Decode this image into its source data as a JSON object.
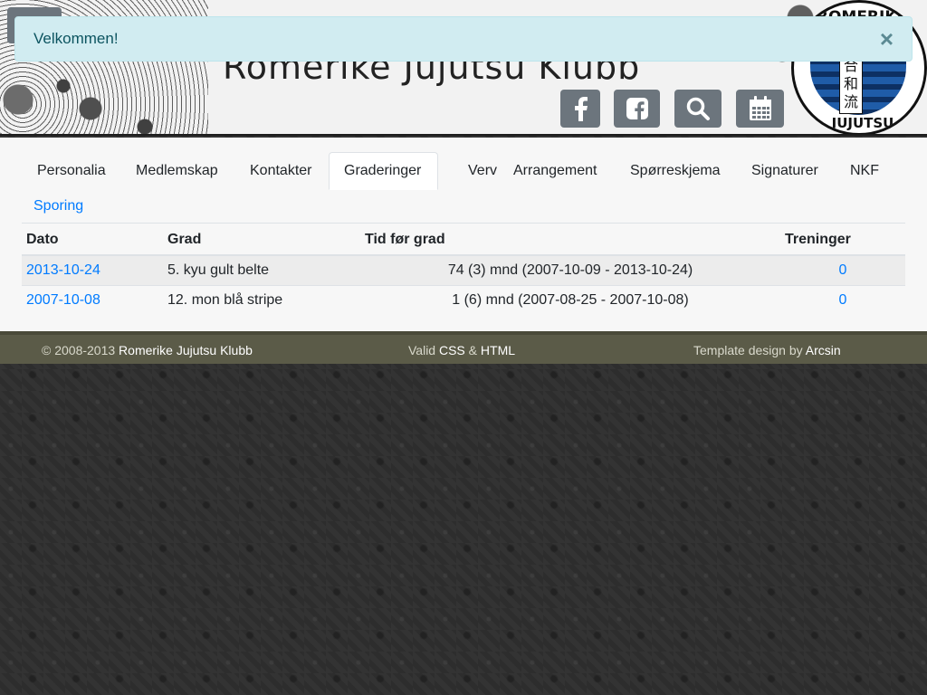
{
  "alert": {
    "message": "Velkommen!",
    "close_glyph": "×"
  },
  "header": {
    "title": "Romerike Jujutsu Klubb",
    "icons": [
      "facebook-icon",
      "facebook-square-icon",
      "search-icon",
      "calendar-icon"
    ],
    "logo": {
      "top_text": "ROMERIKE",
      "bottom_text": "JUJUTSU KLUBB",
      "kanji": "合和流"
    }
  },
  "tabs": [
    {
      "label": "Personalia"
    },
    {
      "label": "Medlemskap"
    },
    {
      "label": "Kontakter"
    },
    {
      "label": "Graderinger"
    },
    {
      "label": "Verv"
    },
    {
      "label": "Arrangement"
    },
    {
      "label": "Spørreskjema"
    },
    {
      "label": "Signaturer"
    },
    {
      "label": "NKF"
    },
    {
      "label": "Sporing"
    }
  ],
  "active_tab": "Graderinger",
  "table": {
    "headers": {
      "dato": "Dato",
      "grad": "Grad",
      "tid": "Tid før grad",
      "treninger": "Treninger"
    },
    "rows": [
      {
        "dato": "2013-10-24",
        "grad": "5. kyu gult belte",
        "tid": "74 (3) mnd (2007-10-09 - 2013-10-24)",
        "treninger": "0"
      },
      {
        "dato": "2007-10-08",
        "grad": "12. mon blå stripe",
        "tid": "1 (6) mnd (2007-08-25 - 2007-10-08)",
        "treninger": "0"
      }
    ]
  },
  "footer": {
    "copyright": "© 2008-2013",
    "club": "Romerike Jujutsu Klubb",
    "valid": "Valid",
    "css": "CSS",
    "amp": "&",
    "html": "HTML",
    "template": "Template design by",
    "designer": "Arcsin"
  },
  "colors": {
    "link": "#007bff",
    "alert_bg": "#d1ecf1",
    "alert_text": "#0c5460",
    "icon_button": "#6c757d",
    "footer_bg": "#5b5b48"
  }
}
